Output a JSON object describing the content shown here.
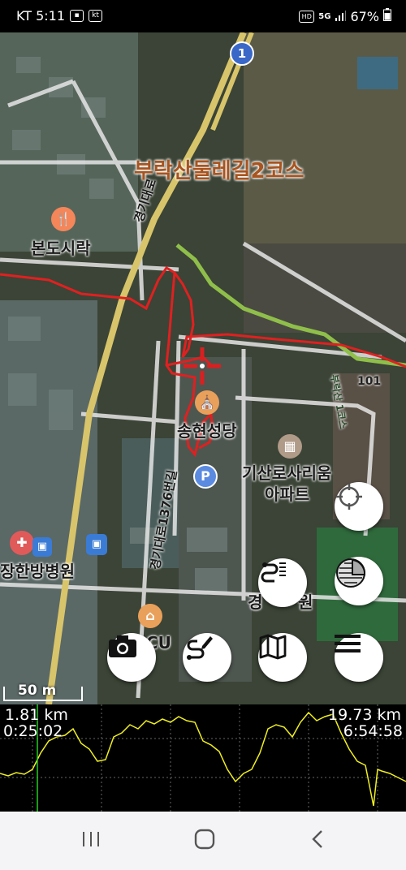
{
  "status_bar": {
    "carrier_time": "KT 5:11",
    "kt_badge": "kt",
    "hd_badge": "HD",
    "network": "5G",
    "battery": "67%",
    "icons": [
      "gallery-icon",
      "kt-icon",
      "hd-voice-icon",
      "signal-icon",
      "battery-icon"
    ]
  },
  "map": {
    "route_name": "부락산둘레길2코스",
    "labels": {
      "restaurant": "본도시락",
      "church": "송현성당",
      "apartment_line1": "기산로사리움",
      "apartment_line2": "아파트",
      "hospital": "장한방병원",
      "building_num": "101",
      "partial_bottom": "경",
      "partial_bottom2": "원",
      "cu": "CU"
    },
    "roads": {
      "gyeonggi_daero": "경기대로",
      "side_road": "경기대로1376번길"
    },
    "highway_shield": "1",
    "scale_label": "50 m",
    "trail_label": "부락산 1코스",
    "colors": {
      "track": "#e02020",
      "trail": "#8fbf4a",
      "highway": "#d8c46a",
      "poi_food": "#f4865a",
      "poi_church": "#e9a05a",
      "poi_parking": "#5a8be0",
      "poi_bus": "#3a7bd5"
    }
  },
  "buttons": {
    "locate": "crosshair-icon",
    "layers": "map-layers-icon",
    "route_list": "route-list-icon",
    "camera": "camera-icon",
    "draw_route": "draw-route-icon",
    "map": "map-icon",
    "menu": "menu-icon"
  },
  "profile": {
    "current_distance": "1.81 km",
    "total_distance": "19.73 km",
    "current_time": "0:25:02",
    "total_time": "6:54:58",
    "cursor_fraction": 0.092,
    "line_color": "#f0f020",
    "cursor_color": "#22cc22"
  },
  "nav_bar": {
    "recent": "recent-apps-icon",
    "home": "home-icon",
    "back": "back-icon"
  }
}
